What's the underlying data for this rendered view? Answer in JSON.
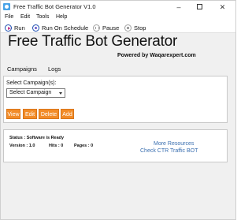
{
  "window": {
    "title": "Free Traffic Bot Generator V1.0",
    "minimize_glyph": "–",
    "close_glyph": "✕"
  },
  "menu": [
    "File",
    "Edit",
    "Tools",
    "Help"
  ],
  "toolbar": {
    "run": "Run",
    "run_on_schedule": "Run On Schedule",
    "pause": "Pause",
    "stop": "Stop"
  },
  "header": {
    "title": "Free Traffic Bot Generator",
    "subtitle": "Powered by Waqarexpert.com"
  },
  "tabs": [
    "Campaigns",
    "Logs"
  ],
  "campaign_panel": {
    "select_label": "Select Campaign(s):",
    "select_value": "Select Campaign",
    "buttons": {
      "view": "View",
      "edit": "Edit",
      "delete": "Delete",
      "add": "Add"
    }
  },
  "status_panel": {
    "status": "Status : Software is Ready",
    "version": "Version : 1.0",
    "hits": "Hits : 0",
    "pages": "Pages : 0",
    "more_resources": "More Resources",
    "check_ctr": "Check CTR Traffic BOT"
  },
  "colors": {
    "button_bg": "#f28c28",
    "link": "#3a6fb0",
    "icon_accent": "#1b4fb0"
  }
}
